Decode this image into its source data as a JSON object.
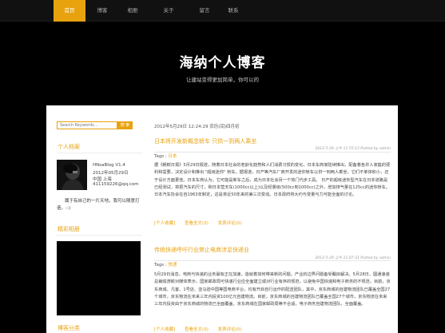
{
  "nav": {
    "items": [
      {
        "label": "首页",
        "active": true
      },
      {
        "label": "博客",
        "active": false
      },
      {
        "label": "相册",
        "active": false
      },
      {
        "label": "关于",
        "active": false
      },
      {
        "label": "留言",
        "active": false
      },
      {
        "label": "联系",
        "active": false
      }
    ]
  },
  "hero": {
    "title": "海纳个人博客",
    "subtitle": "让建站变得更加简单，你可以的"
  },
  "sidebar": {
    "search": {
      "placeholder": "Search Keywords...",
      "button": "搜 索"
    },
    "profile": {
      "title": "个人档案",
      "lines": [
        "HNsaBlog V1.4",
        "2012年05月29日",
        "中国 上海",
        "411159226@qq.com"
      ],
      "description": "属于有自己的一片天地，我可以随意打造，:-)"
    },
    "photo_section": {
      "title": "精彩相册"
    },
    "category_section": {
      "title": "博客分类"
    }
  },
  "main": {
    "date_header": "2012年5月29日 12:24:29 农历(闰)四月初",
    "posts": [
      {
        "title": "日本将开发新概念轿车 只供一到两人乘坐",
        "meta": "2012-5-29 上午 11:55:13 Posted by admin",
        "tags_label": "Tags :",
        "tags": "日本",
        "body": "据《朝鲜日报》5月29日报道，随着日本社会的老龄化趋势和人们消费习惯的变化，日本车商家陆续推出，配备着各并人家庭的便利和需要，决定设计和推出 \"超级迷你\" 轿车。据报道，日产等汽车厂商开发的迷你轿车以供一到两人乘坐，它们不单体积小，还于设计方面更佳。日本车商认为，它可能是新车之后，成为日本社会另一个热门代步工具。 日产的超级迷你型汽车在日本道路是已经测试，将把汽车的尺寸，和日本营天车(1000cc以上)以及轻量级(500cc到1000cc)之外，增加排气量在125cc的迷你轿车。日本汽车协会在自1963年制定，这是将近50年来的第三次变动。日本政府将大约与变量与力可能全面的讨论。",
        "links": [
          "[个人收藏]",
          "查看全文(0)",
          "发表评论(0)"
        ]
      },
      {
        "title": "传统快递呼吁行业禁止电商涉足快递业",
        "meta": "2012-5-29 上午 11:07:31 Posted by admin",
        "tags_label": "Tags :",
        "tags": "快递",
        "body": "5月29日消息，电商与快递的业务最有正在加速，造就着如何带来新的问题。产业的边界问题备受瞩目解决。5月28日，圆通速递总裁喻渭蛟对媒体表示，国家邮政局可快递行业应全面建立或对行业有序的规范，以避免中国快递和电子商务的不规范，目前，京东商城、凡客、1号店、亚马逊中国等国电商平台，均有开启自行运作的配送团队，其中，京东商城的自建物流团队已覆盖全国27个城市，京东物流在未来三年内投资100亿元自建物流。目前，京东商城的自建物流团队已覆盖全国27个城市，京东物流在未来三年内投资由于京东商城的物流已全面覆盖，京东商城在国家邮政局等不合适，电子商务自建物流团队，全面覆盖。",
        "links": [
          "[个人收藏]",
          "查看全文(0)",
          "发表评论(0)"
        ]
      }
    ]
  }
}
